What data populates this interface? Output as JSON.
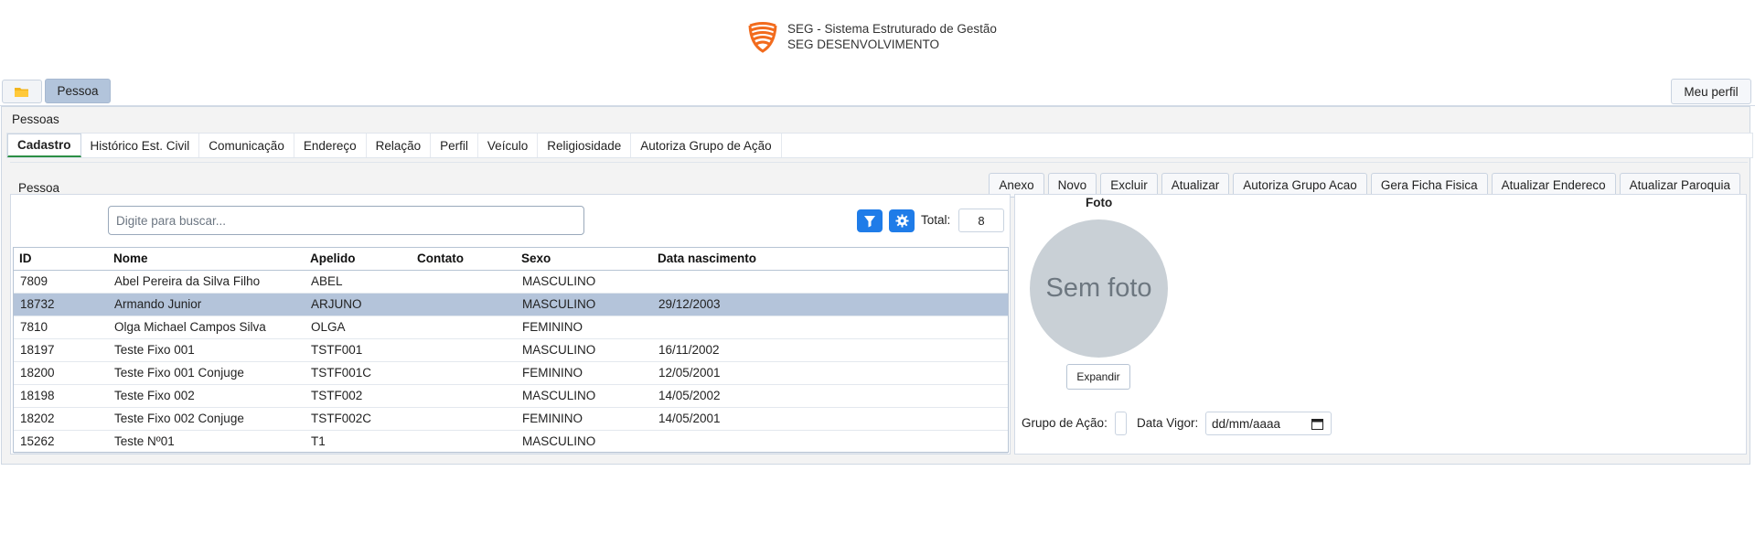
{
  "app": {
    "title": "SEG - Sistema Estruturado de Gestão",
    "subtitle": "SEG DESENVOLVIMENTO",
    "brand_color": "#f26b1d"
  },
  "topbar": {
    "folder_icon": "folder-icon",
    "active_tab": "Pessoa",
    "profile_button": "Meu perfil"
  },
  "frame": {
    "title": "Pessoas"
  },
  "subtabs": [
    "Cadastro",
    "Histórico Est. Civil",
    "Comunicação",
    "Endereço",
    "Relação",
    "Perfil",
    "Veículo",
    "Religiosidade",
    "Autoriza Grupo de Ação"
  ],
  "panel": {
    "title": "Pessoa",
    "actions": [
      "Anexo",
      "Novo",
      "Excluir",
      "Atualizar",
      "Autoriza Grupo Acao",
      "Gera Ficha Fisica",
      "Atualizar Endereco",
      "Atualizar Paroquia"
    ]
  },
  "search": {
    "placeholder": "Digite para buscar...",
    "total_label": "Total:",
    "total_value": "8"
  },
  "table": {
    "columns": [
      "ID",
      "Nome",
      "Apelido",
      "Contato",
      "Sexo",
      "Data nascimento"
    ],
    "selected_row": 1,
    "rows": [
      [
        "7809",
        "Abel Pereira da Silva Filho",
        "ABEL",
        "",
        "MASCULINO",
        ""
      ],
      [
        "18732",
        "Armando Junior",
        "ARJUNO",
        "",
        "MASCULINO",
        "29/12/2003"
      ],
      [
        "7810",
        "Olga Michael Campos Silva",
        "OLGA",
        "",
        "FEMININO",
        ""
      ],
      [
        "18197",
        "Teste Fixo 001",
        "TSTF001",
        "",
        "MASCULINO",
        "16/11/2002"
      ],
      [
        "18200",
        "Teste Fixo 001 Conjuge",
        "TSTF001C",
        "",
        "FEMININO",
        "12/05/2001"
      ],
      [
        "18198",
        "Teste Fixo 002",
        "TSTF002",
        "",
        "MASCULINO",
        "14/05/2002"
      ],
      [
        "18202",
        "Teste Fixo 002 Conjuge",
        "TSTF002C",
        "",
        "FEMININO",
        "14/05/2001"
      ],
      [
        "15262",
        "Teste Nº01",
        "T1",
        "",
        "MASCULINO",
        ""
      ]
    ]
  },
  "photo": {
    "label": "Foto",
    "placeholder": "Sem foto",
    "expand_button": "Expandir"
  },
  "form": {
    "grupo_label": "Grupo de Ação:",
    "data_vigor_label": "Data Vigor:",
    "data_vigor_value": "dd/mm/aaaa"
  },
  "colors": {
    "accent": "#1f7ce8",
    "selected_row": "#b4c4da",
    "active_tab_bg": "#b2c4db"
  }
}
